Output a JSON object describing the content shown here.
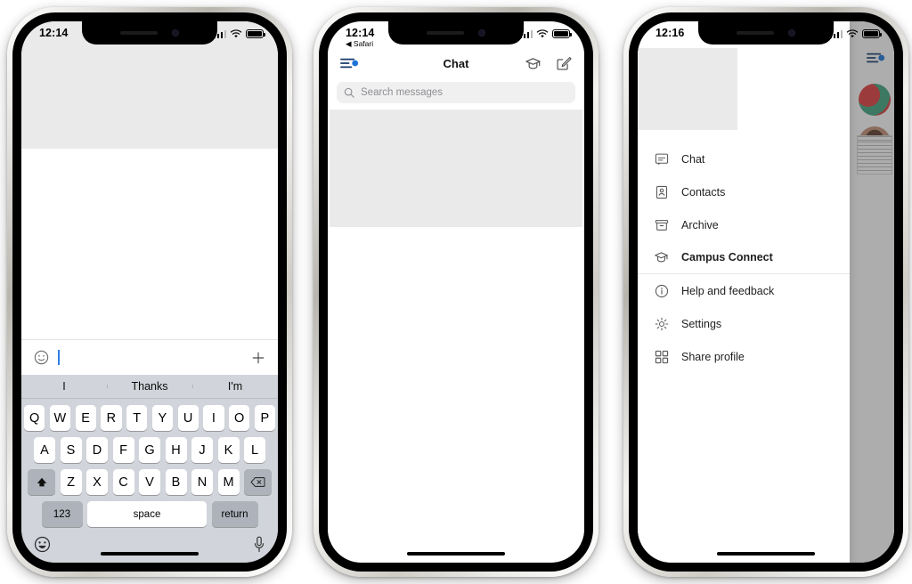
{
  "phones": [
    {
      "id": "compose",
      "status": {
        "time": "12:14",
        "back_label": "",
        "signal": "signal-bars",
        "wifi": "wifi-icon",
        "battery": "battery-icon"
      },
      "input": {
        "emoji_icon": "emoji-smiley-outline-icon",
        "value": "",
        "placeholder": "",
        "plus_icon": "plus-icon"
      },
      "keyboard": {
        "suggestions": [
          "I",
          "Thanks",
          "I'm"
        ],
        "row1": [
          "Q",
          "W",
          "E",
          "R",
          "T",
          "Y",
          "U",
          "I",
          "O",
          "P"
        ],
        "row2": [
          "A",
          "S",
          "D",
          "F",
          "G",
          "H",
          "J",
          "K",
          "L"
        ],
        "row3": [
          "Z",
          "X",
          "C",
          "V",
          "B",
          "N",
          "M"
        ],
        "shift_label": "shift-icon",
        "backspace_label": "backspace-icon",
        "numbers_label": "123",
        "space_label": "space",
        "return_label": "return",
        "emoji_label": "emoji-icon",
        "mic_label": "microphone-icon"
      }
    },
    {
      "id": "chat-list",
      "status": {
        "time": "12:14",
        "back_label": "◀ Safari",
        "signal": "signal-bars",
        "wifi": "wifi-icon",
        "battery": "battery-icon"
      },
      "navbar": {
        "menu_icon": "hamburger-menu-icon",
        "title": "Chat",
        "graduation_icon": "graduation-cap-icon",
        "compose_icon": "compose-edit-icon"
      },
      "search": {
        "icon": "search-icon",
        "placeholder": "Search messages",
        "value": ""
      }
    },
    {
      "id": "drawer",
      "status": {
        "time": "12:16",
        "back_label": "",
        "signal": "signal-bars",
        "wifi": "wifi-icon",
        "battery": "battery-icon"
      },
      "navbar": {
        "menu_icon": "hamburger-menu-icon"
      },
      "drawer": {
        "items": [
          {
            "label": "Chat",
            "icon": "chat-bubble-icon",
            "active": false,
            "divider": false
          },
          {
            "label": "Contacts",
            "icon": "contact-card-icon",
            "active": false,
            "divider": false
          },
          {
            "label": "Archive",
            "icon": "archive-box-icon",
            "active": false,
            "divider": false
          },
          {
            "label": "Campus Connect",
            "icon": "graduation-cap-icon",
            "active": true,
            "divider": true
          },
          {
            "label": "Help and feedback",
            "icon": "info-circle-icon",
            "active": false,
            "divider": false
          },
          {
            "label": "Settings",
            "icon": "gear-icon",
            "active": false,
            "divider": false
          },
          {
            "label": "Share profile",
            "icon": "qr-code-icon",
            "active": false,
            "divider": false
          }
        ]
      }
    }
  ],
  "colors": {
    "accent": "#2e7de3",
    "keyboard_bg": "#d1d4da",
    "key_bg": "#ffffff",
    "key_alt_bg": "#adb2bb",
    "placeholder_gray": "#eaeaea"
  }
}
